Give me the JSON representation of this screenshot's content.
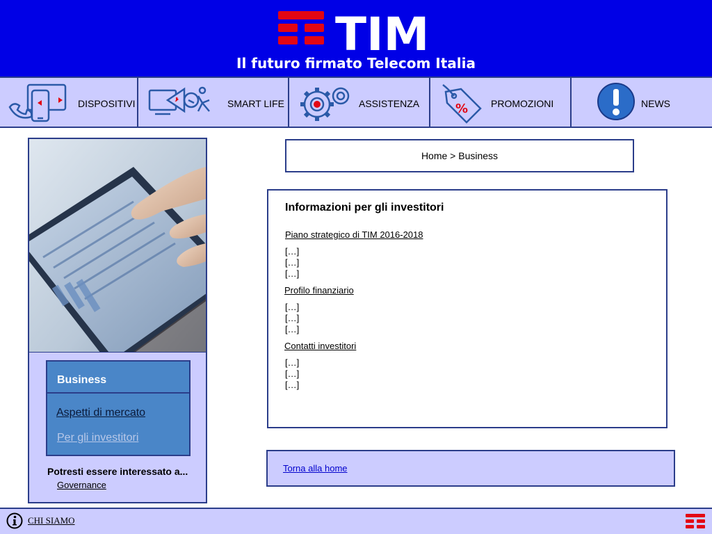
{
  "header": {
    "logo_text": "TIM",
    "tagline": "Il futuro firmato Telecom Italia"
  },
  "nav": {
    "items": [
      {
        "label": "DISPOSITIVI",
        "icon": "devices-icon"
      },
      {
        "label": "SMART LIFE",
        "icon": "smart-life-icon"
      },
      {
        "label": "ASSISTENZA",
        "icon": "gears-icon"
      },
      {
        "label": "PROMOZIONI",
        "icon": "discount-tag-icon"
      },
      {
        "label": "NEWS",
        "icon": "exclamation-icon"
      }
    ]
  },
  "sidebar": {
    "menu_title": "Business",
    "menu_links": [
      "Aspetti di mercato",
      "Per gli investitori"
    ],
    "interest_heading": "Potresti essere interessato a...",
    "interest_link": "Governance"
  },
  "breadcrumb": "Home > Business",
  "content": {
    "title": "Informazioni per gli investitori",
    "sections": [
      {
        "link": "Piano strategico di TIM 2016-2018",
        "lines": [
          "[…]",
          "[…]",
          "[…]"
        ]
      },
      {
        "link": "Profilo finanziario",
        "lines": [
          "[…]",
          "[…]",
          "[…]"
        ]
      },
      {
        "link": "Contatti investitori",
        "lines": [
          "[…]",
          "[…]",
          "[…]"
        ]
      }
    ]
  },
  "back_home": "Torna alla home",
  "footer": {
    "link": "CHI SIAMO",
    "icon": "info-icon"
  },
  "colors": {
    "header_blue": "#0000e6",
    "nav_lavender": "#ccccff",
    "border_navy": "#2b3d8a",
    "menu_blue": "#4a86c8",
    "logo_red": "#e30613"
  }
}
